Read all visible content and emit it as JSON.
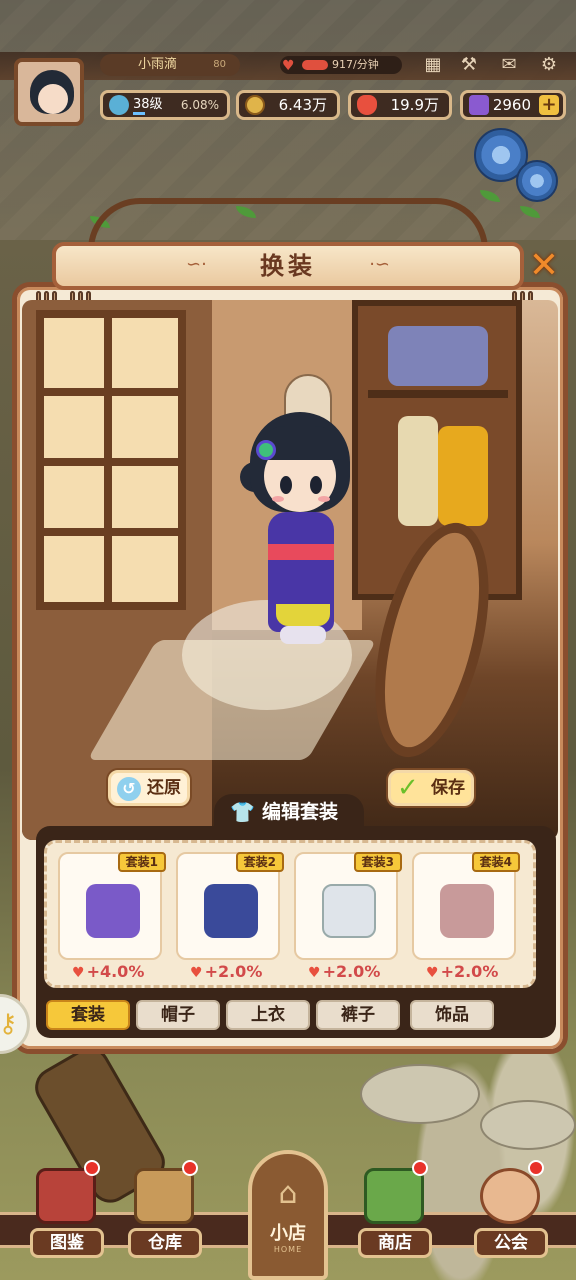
{
  "colors": {
    "accent": "#f6c83a",
    "brand_brown": "#8a4e2e",
    "bonus_red": "#d24a4a"
  },
  "hud": {
    "player_name": "小雨滴",
    "player_extra": "80",
    "heart_rate": "917/分钟",
    "level": "38级",
    "level_progress": "6.08%",
    "coins": "6.43万",
    "hearts": "19.9万",
    "gems": "2960",
    "icons": [
      "calendar-icon",
      "broom-icon",
      "mail-icon",
      "gear-icon"
    ]
  },
  "dialog": {
    "title": "换装",
    "restore_label": "还原",
    "save_label": "保存",
    "edit_label": "编辑套装"
  },
  "outfits": [
    {
      "tag": "套装1",
      "bonus": "+4.0%",
      "color": "#7a5ac8"
    },
    {
      "tag": "套装2",
      "bonus": "+2.0%",
      "color": "#3a4a9a"
    },
    {
      "tag": "套装3",
      "bonus": "+2.0%",
      "color": "#dfe4ea"
    },
    {
      "tag": "套装4",
      "bonus": "+2.0%",
      "color": "#c89a9a"
    }
  ],
  "tabs": [
    "套装",
    "帽子",
    "上衣",
    "裤子",
    "饰品"
  ],
  "active_tab": "套装",
  "nav": {
    "items": [
      "图鉴",
      "仓库",
      "商店",
      "公会"
    ],
    "home_label": "小店",
    "home_sub": "HOME"
  }
}
